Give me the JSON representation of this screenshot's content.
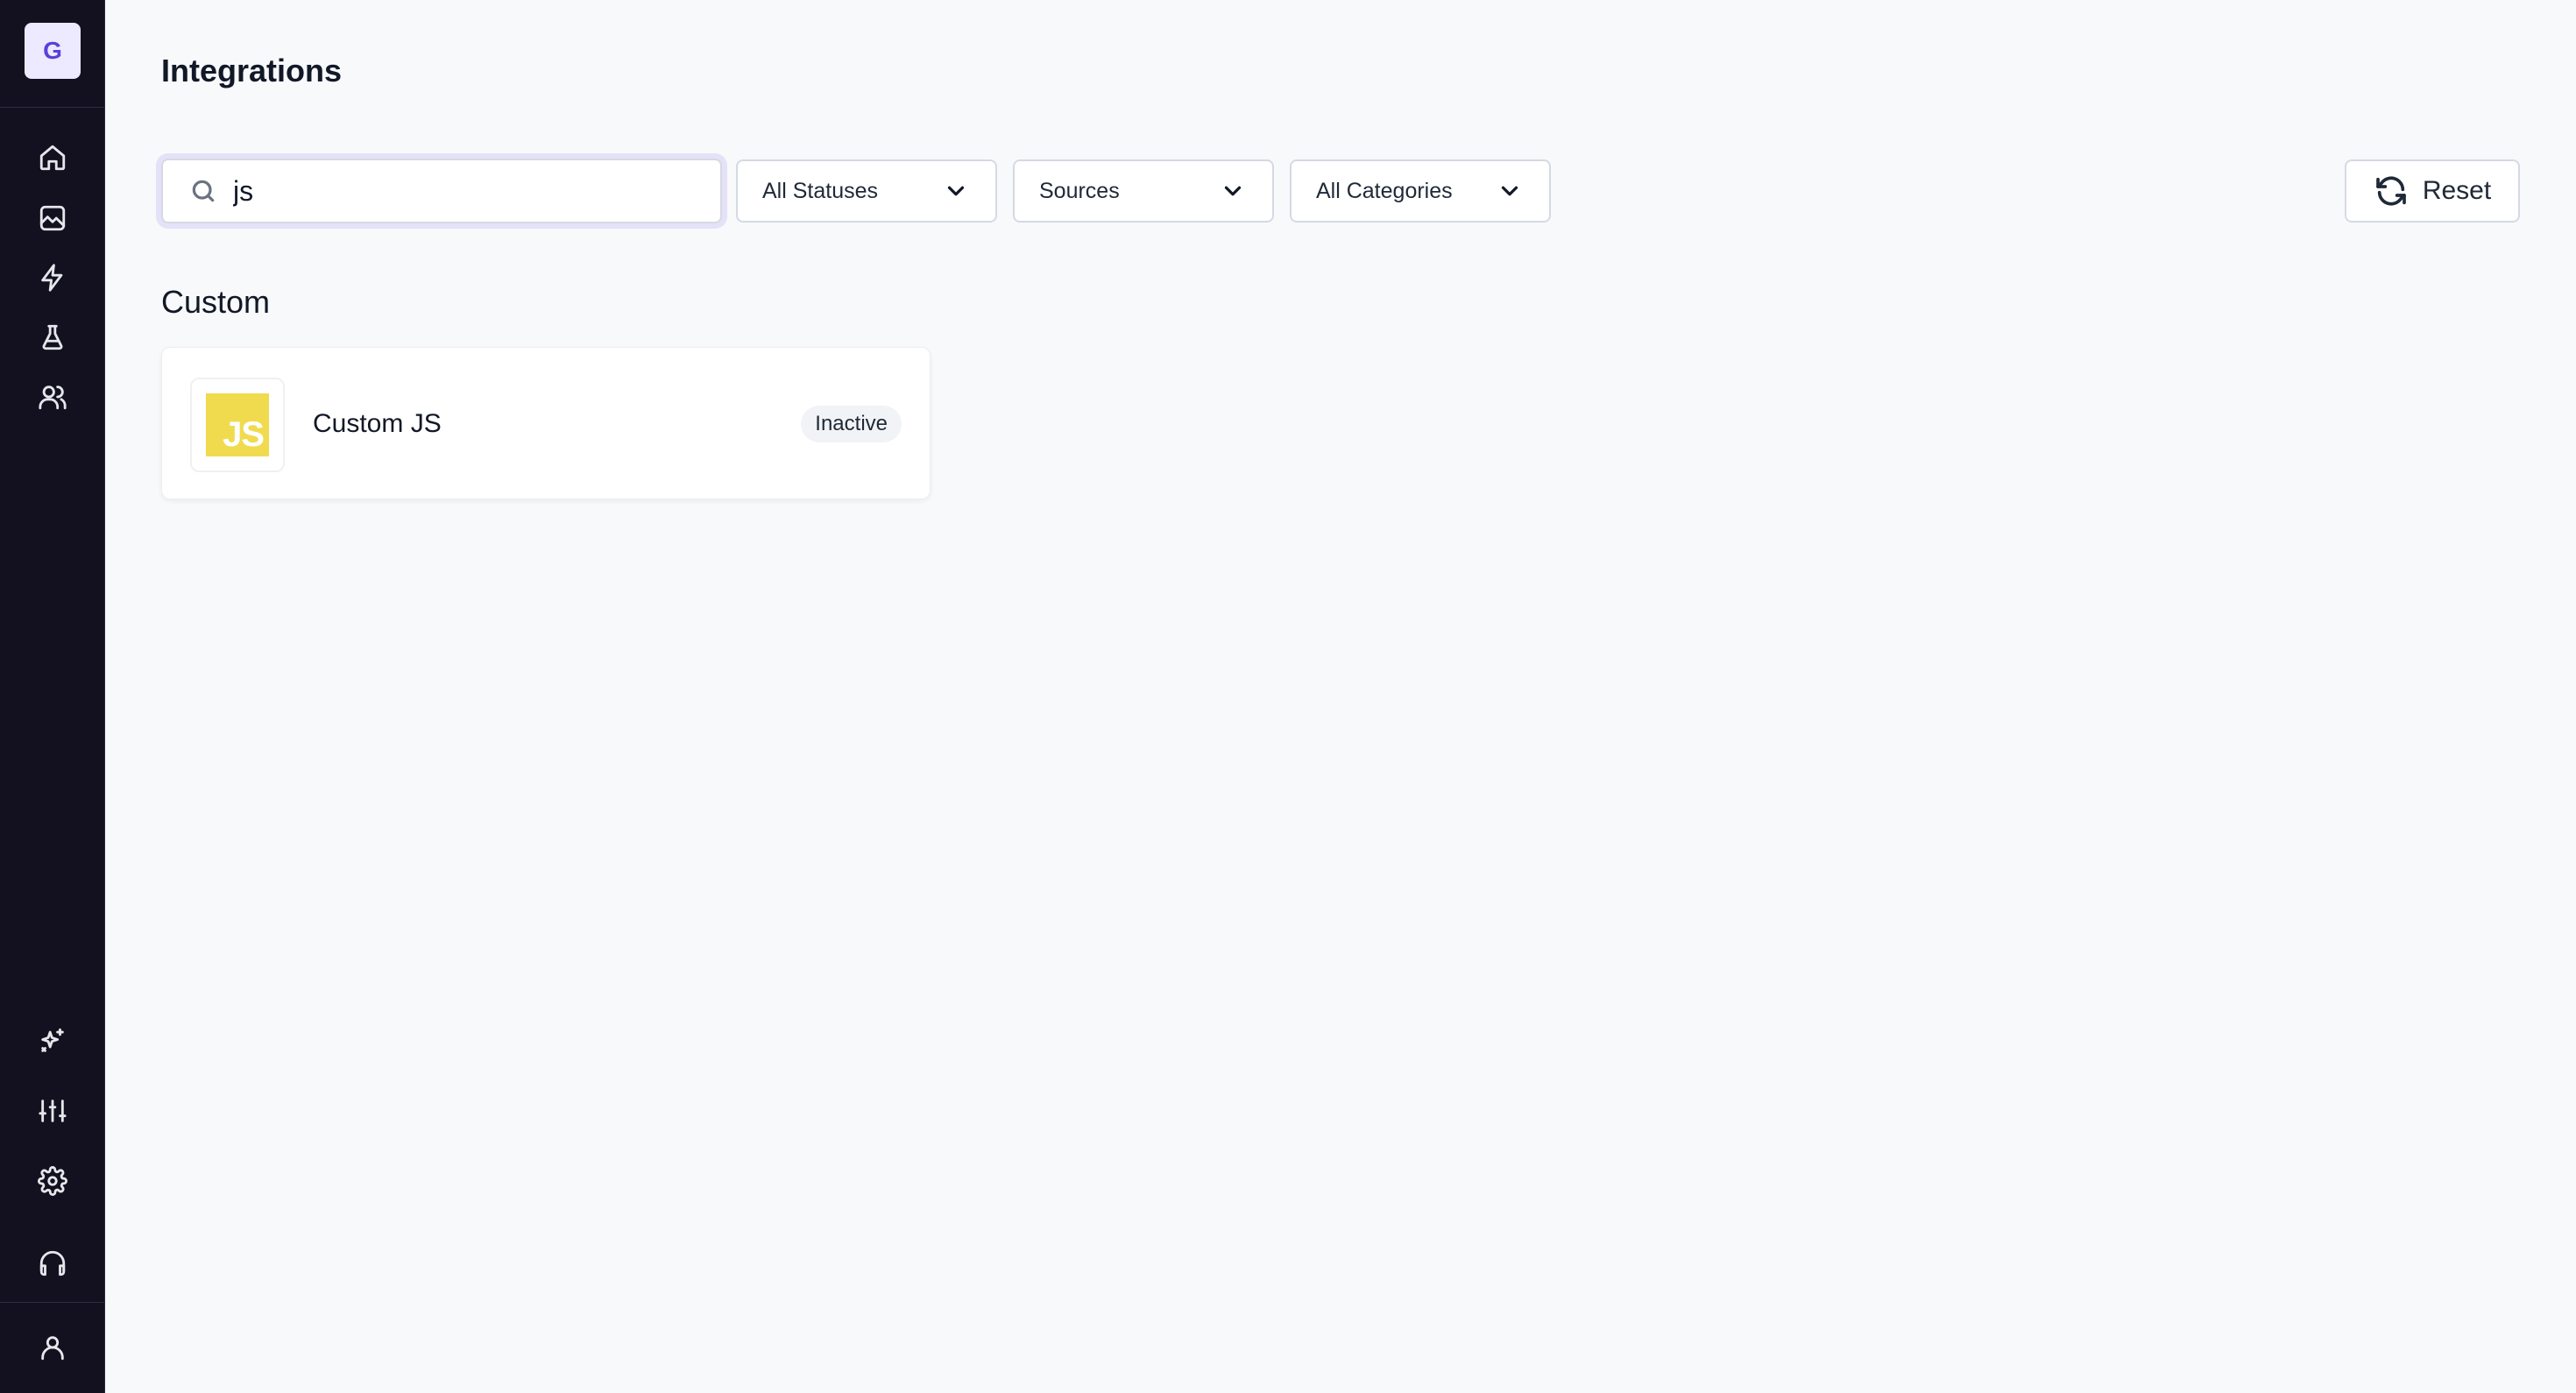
{
  "sidebar": {
    "workspace_initial": "G",
    "top_icons": [
      "home-icon",
      "analytics-icon",
      "lightning-icon",
      "flask-icon",
      "users-icon"
    ],
    "bottom_icons": [
      "sparkles-icon",
      "sliders-icon",
      "gear-icon",
      "headphones-icon",
      "user-icon"
    ]
  },
  "page": {
    "title": "Integrations"
  },
  "filters": {
    "search_value": "js",
    "search_placeholder": "",
    "status_select": "All Statuses",
    "sources_select": "Sources",
    "categories_select": "All Categories",
    "reset_label": "Reset"
  },
  "sections": [
    {
      "title": "Custom",
      "items": [
        {
          "name": "Custom JS",
          "logo_text": "JS",
          "status": "Inactive"
        }
      ]
    }
  ],
  "colors": {
    "sidebar_bg": "#13111f",
    "accent": "#5b3fd9",
    "js_yellow": "#f0db4f"
  }
}
